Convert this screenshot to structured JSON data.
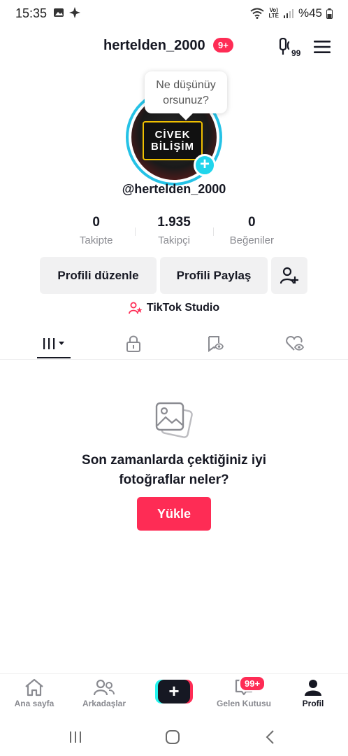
{
  "status_bar": {
    "time": "15:35",
    "volte": "Vo)\nLTE",
    "battery": "%45"
  },
  "header": {
    "username": "hertelden_2000",
    "notification_badge": "9+",
    "creator_icon": "creator-tools-icon",
    "menu_icon": "hamburger-menu-icon"
  },
  "profile": {
    "bubble_text": "Ne düşünüy orsunuz?",
    "avatar_sign_line1": "CİVEK",
    "avatar_sign_line2": "BİLİŞİM",
    "handle": "@hertelden_2000",
    "stats": [
      {
        "value": "0",
        "label": "Takipte"
      },
      {
        "value": "1.935",
        "label": "Takipçi"
      },
      {
        "value": "0",
        "label": "Beğeniler"
      }
    ],
    "buttons": {
      "edit": "Profili düzenle",
      "share": "Profili Paylaş"
    },
    "studio": "TikTok Studio"
  },
  "tabs": [
    "videos-grid-icon",
    "lock-icon",
    "bookmark-icon",
    "liked-icon"
  ],
  "empty_state": {
    "line1": "Son zamanlarda çektiğiniz iyi",
    "line2": "fotoğraflar neler?",
    "upload_label": "Yükle"
  },
  "bottom_nav": {
    "items": [
      {
        "label": "Ana sayfa"
      },
      {
        "label": "Arkadaşlar"
      },
      {
        "label": "Gelen Kutusu"
      },
      {
        "label": "Profil"
      }
    ],
    "inbox_badge": "99+"
  },
  "colors": {
    "accent": "#fe2c55",
    "cyan": "#25c2e6",
    "text": "#161823",
    "muted": "#8a8b91"
  }
}
